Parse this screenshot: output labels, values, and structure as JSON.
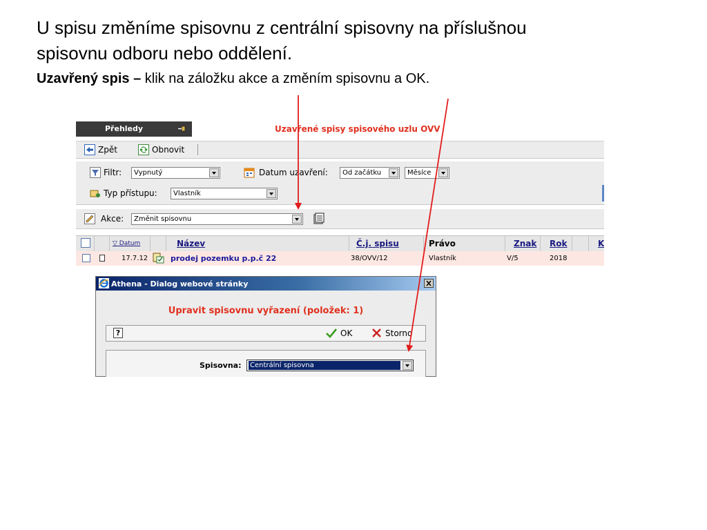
{
  "slide": {
    "heading_line1": "U  spisu změníme spisovnu z centrální  spisovny na příslušnou",
    "heading_line2": "spisovnu odboru nebo oddělení.",
    "sub_bold": "Uzavřený spis –",
    "sub_text": " klik na záložku akce a změním spisovnu a OK."
  },
  "app": {
    "tab_label": "Přehledy",
    "view_title": "Uzavřené spisy spisového uzlu OVV",
    "toolbar": {
      "back_label": "Zpět",
      "refresh_label": "Obnovit"
    },
    "filters": {
      "filter_label": "Filtr:",
      "filter_value": "Vypnutý",
      "date_label": "Datum uzavření:",
      "date_from_value": "Od začátku",
      "date_unit_value": "Měsíce",
      "access_label": "Typ přístupu:",
      "access_value": "Vlastník"
    },
    "akce": {
      "label": "Akce:",
      "value": "Změnit spisovnu"
    },
    "table": {
      "headers": {
        "datum": "Datum",
        "nazev": "Název",
        "cj": "Č.j. spisu",
        "pravo": "Právo",
        "znak": "Znak",
        "rok": "Rok",
        "k": "K"
      },
      "rows": [
        {
          "datum": "17.7.12",
          "nazev": "prodej pozemku p.p.č 22",
          "cj": "38/OVV/12",
          "pravo": "Vlastník",
          "znak": "V/5",
          "rok": "2018"
        }
      ]
    },
    "dialog": {
      "title": "Athena - Dialog webové stránky",
      "heading": "Upravit spisovnu vyřazení (položek: 1)",
      "help_label": "?",
      "ok_label": "OK",
      "cancel_label": "Storno",
      "spisovna_label": "Spisovna:",
      "spisovna_value": "Centrální spisovna"
    }
  },
  "colors": {
    "arrow": "#e21b1b",
    "title_red": "#e0301e",
    "link_blue": "#1a1a80"
  }
}
